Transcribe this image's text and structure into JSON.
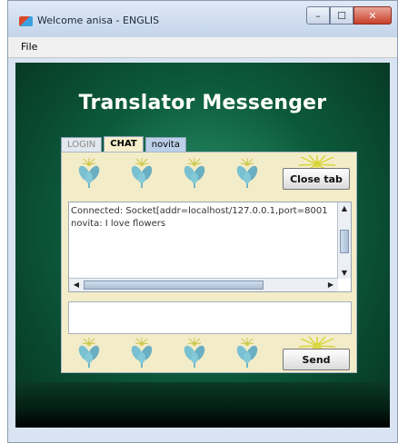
{
  "window": {
    "title": "Welcome anisa - ENGLIS",
    "controls": {
      "minimize": "–",
      "maximize": "☐",
      "close": "✕"
    }
  },
  "menu": {
    "file": "File"
  },
  "app": {
    "title": "Translator Messenger"
  },
  "tabs": [
    {
      "label": "LOGIN",
      "state": "inactive"
    },
    {
      "label": "CHAT",
      "state": "selected"
    },
    {
      "label": "novita",
      "state": "open"
    }
  ],
  "chat": {
    "close_tab_label": "Close tab",
    "send_label": "Send",
    "messages": [
      "Connected: Socket[addr=localhost/127.0.0.1,port=8001",
      "novita: I love flowers"
    ],
    "input_value": ""
  },
  "colors": {
    "panel_bg": "#f3ecc8",
    "background_green": "#0c5a3b",
    "flower_blue": "#6fb6c8",
    "burst_yellow": "#e7e34c"
  },
  "icons": {
    "flower": "flower-icon",
    "burst": "sun-burst-icon",
    "app": "java-app-icon"
  }
}
